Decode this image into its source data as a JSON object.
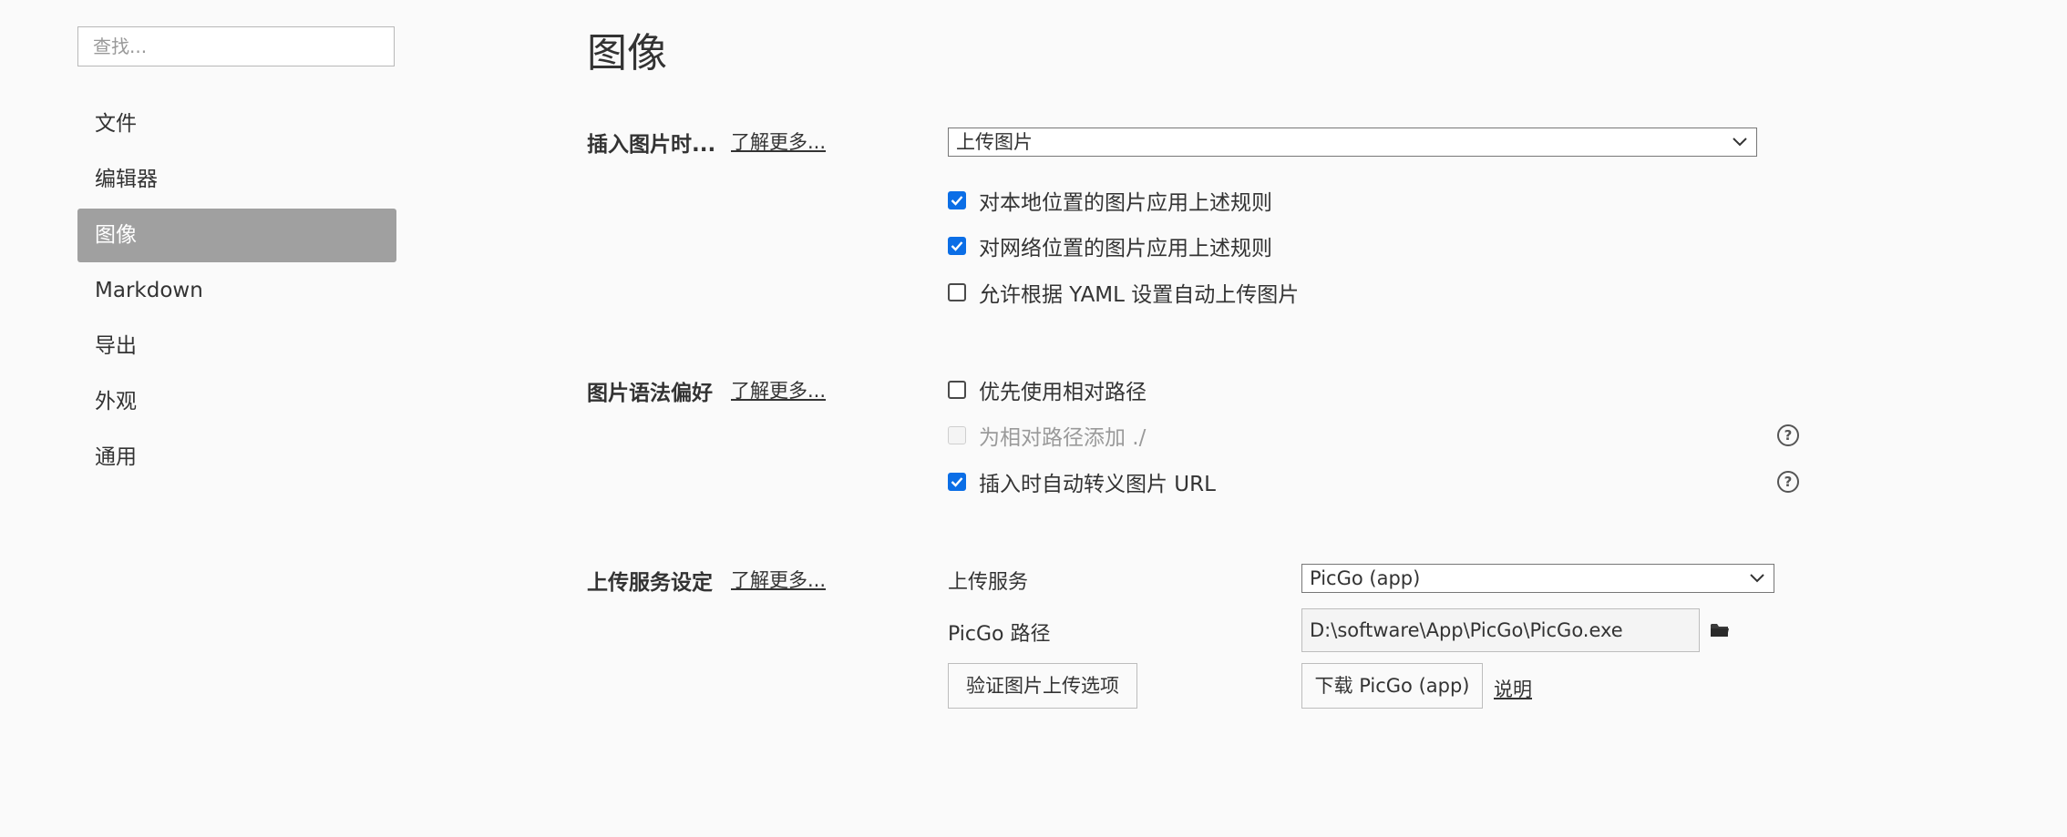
{
  "sidebar": {
    "search_placeholder": "查找...",
    "items": [
      {
        "label": "文件"
      },
      {
        "label": "编辑器"
      },
      {
        "label": "图像"
      },
      {
        "label": "Markdown"
      },
      {
        "label": "导出"
      },
      {
        "label": "外观"
      },
      {
        "label": "通用"
      }
    ]
  },
  "main": {
    "title": "图像",
    "insert_section": {
      "label": "插入图片时...",
      "learn_more": "了解更多...",
      "action_select": "上传图片",
      "options": [
        {
          "label": "对本地位置的图片应用上述规则",
          "checked": true
        },
        {
          "label": "对网络位置的图片应用上述规则",
          "checked": true
        },
        {
          "label": "允许根据 YAML 设置自动上传图片",
          "checked": false
        }
      ]
    },
    "syntax_section": {
      "label": "图片语法偏好",
      "learn_more": "了解更多...",
      "options": [
        {
          "label": "优先使用相对路径",
          "checked": false
        },
        {
          "label": "为相对路径添加 ./",
          "checked": false,
          "disabled": true
        },
        {
          "label": "插入时自动转义图片 URL",
          "checked": true
        }
      ]
    },
    "upload_section": {
      "label": "上传服务设定",
      "learn_more": "了解更多...",
      "service_label": "上传服务",
      "service_value": "PicGo (app)",
      "path_label": "PicGo 路径",
      "path_value": "D:\\software\\App\\PicGo\\PicGo.exe",
      "verify_button": "验证图片上传选项",
      "download_button": "下载 PicGo (app)",
      "help_link": "说明"
    }
  },
  "colors": {
    "accent": "#0b6ee6",
    "active_nav_bg": "#a0a0a0",
    "background": "#fafafa"
  }
}
